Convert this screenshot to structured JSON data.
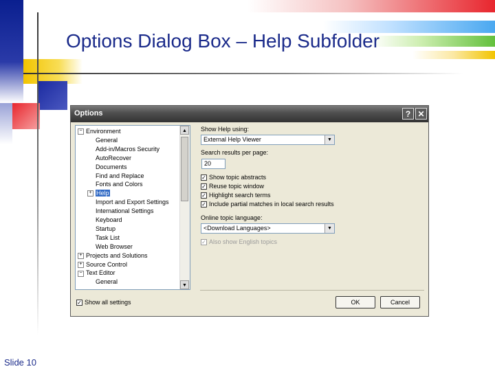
{
  "slide": {
    "title": "Options Dialog Box – Help Subfolder",
    "number": "Slide 10"
  },
  "dialog": {
    "title": "Options",
    "help_button": "?",
    "close_button": "✕",
    "tree": [
      {
        "label": "Environment",
        "expander": "−"
      },
      {
        "label": "General"
      },
      {
        "label": "Add-in/Macros Security"
      },
      {
        "label": "AutoRecover"
      },
      {
        "label": "Documents"
      },
      {
        "label": "Find and Replace"
      },
      {
        "label": "Fonts and Colors"
      },
      {
        "label": "Help",
        "expander": "+",
        "selected": true
      },
      {
        "label": "Import and Export Settings"
      },
      {
        "label": "International Settings"
      },
      {
        "label": "Keyboard"
      },
      {
        "label": "Startup"
      },
      {
        "label": "Task List"
      },
      {
        "label": "Web Browser"
      },
      {
        "label": "Projects and Solutions",
        "expander": "+"
      },
      {
        "label": "Source Control",
        "expander": "+"
      },
      {
        "label": "Text Editor",
        "expander": "−"
      },
      {
        "label": "General"
      }
    ],
    "show_help_label": "Show Help using:",
    "show_help_value": "External Help Viewer",
    "results_label": "Search results per page:",
    "results_value": "20",
    "checkboxes": [
      {
        "label": "Show topic abstracts",
        "checked": true
      },
      {
        "label": "Reuse topic window",
        "checked": true
      },
      {
        "label": "Highlight search terms",
        "checked": true
      },
      {
        "label": "Include partial matches in local search results",
        "checked": true
      }
    ],
    "online_lang_label": "Online topic language:",
    "online_lang_value": "<Download Languages>",
    "english_topics": {
      "label": "Also show English topics",
      "checked": true,
      "disabled": true
    },
    "show_all_settings": {
      "label": "Show all settings",
      "checked": true
    },
    "ok_label": "OK",
    "cancel_label": "Cancel",
    "check_mark": "✓",
    "dropdown_arrow": "▼",
    "scroll_up_arrow": "▲",
    "scroll_down_arrow": "▼"
  }
}
